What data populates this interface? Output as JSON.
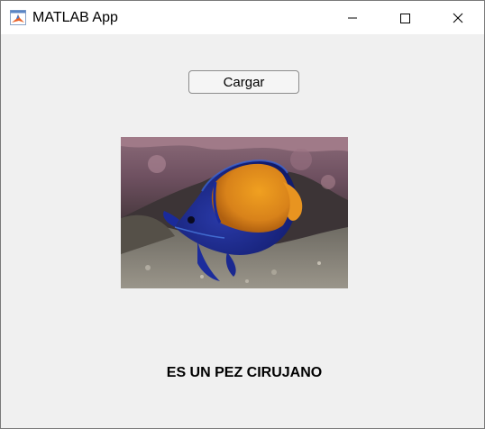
{
  "window": {
    "title": "MATLAB App",
    "icon": "matlab-logo-icon",
    "controls": [
      "minimize-icon",
      "maximize-icon",
      "close-icon"
    ]
  },
  "app": {
    "load_button_label": "Cargar",
    "image": {
      "subject": "fish-photo"
    },
    "result_text": "ES UN PEZ CIRUJANO"
  },
  "colors": {
    "background": "#f0f0f0",
    "titlebar": "#ffffff",
    "button_border": "#8c8c8c"
  }
}
